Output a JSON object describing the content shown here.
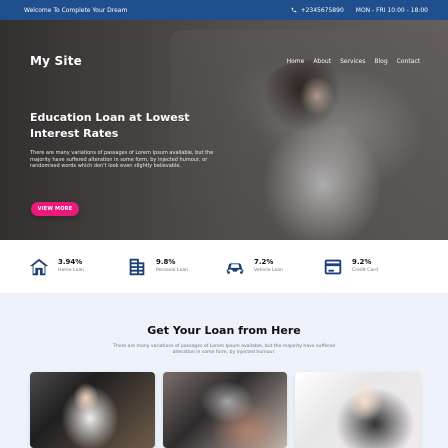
{
  "topbar": {
    "welcome": "Welcome To Complete Your Dream",
    "phone": "+2345675890",
    "hours": "MON - FRI 10:00 - 18:00"
  },
  "nav": {
    "brand": "My Site",
    "items": [
      "Home",
      "About",
      "Services",
      "Blog",
      "Contact"
    ]
  },
  "hero": {
    "title_line1": "Education Loan at Lowest",
    "title_line2": "Interest Rates",
    "paragraph": "There are many variations of passages of Lorem Ipsum available, but the majority have suffered alteration in some form, by injected humour, or randomised words which don't look even slightly believable.",
    "cta_label": "VIEW MORE",
    "accent_color": "#e9197d"
  },
  "rates": [
    {
      "value": "3.94%",
      "label": "Home Loan",
      "icon": "home-icon"
    },
    {
      "value": "9.8%",
      "label": "Personal Loan",
      "icon": "building-icon"
    },
    {
      "value": "7.2%",
      "label": "Vehicle Loan",
      "icon": "car-icon"
    },
    {
      "value": "9.2%",
      "label": "Credit Card",
      "icon": "credit-card-icon"
    }
  ],
  "section": {
    "title": "Get Your Loan from Here",
    "subtitle": "There are many variations of passages of Lorem Ipsum available, but the majority have suffered alteration in some form, by injected humour."
  }
}
